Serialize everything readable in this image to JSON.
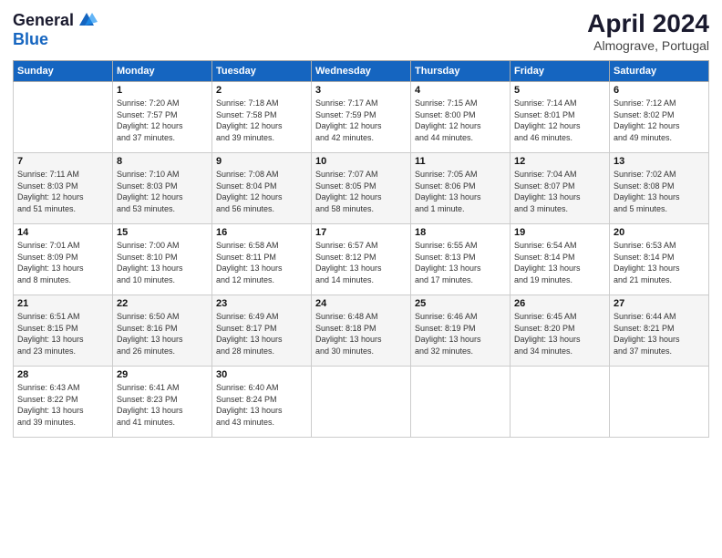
{
  "header": {
    "logo_general": "General",
    "logo_blue": "Blue",
    "main_title": "April 2024",
    "subtitle": "Almograve, Portugal"
  },
  "columns": [
    "Sunday",
    "Monday",
    "Tuesday",
    "Wednesday",
    "Thursday",
    "Friday",
    "Saturday"
  ],
  "weeks": [
    [
      {
        "day": "",
        "info": ""
      },
      {
        "day": "1",
        "info": "Sunrise: 7:20 AM\nSunset: 7:57 PM\nDaylight: 12 hours\nand 37 minutes."
      },
      {
        "day": "2",
        "info": "Sunrise: 7:18 AM\nSunset: 7:58 PM\nDaylight: 12 hours\nand 39 minutes."
      },
      {
        "day": "3",
        "info": "Sunrise: 7:17 AM\nSunset: 7:59 PM\nDaylight: 12 hours\nand 42 minutes."
      },
      {
        "day": "4",
        "info": "Sunrise: 7:15 AM\nSunset: 8:00 PM\nDaylight: 12 hours\nand 44 minutes."
      },
      {
        "day": "5",
        "info": "Sunrise: 7:14 AM\nSunset: 8:01 PM\nDaylight: 12 hours\nand 46 minutes."
      },
      {
        "day": "6",
        "info": "Sunrise: 7:12 AM\nSunset: 8:02 PM\nDaylight: 12 hours\nand 49 minutes."
      }
    ],
    [
      {
        "day": "7",
        "info": "Sunrise: 7:11 AM\nSunset: 8:03 PM\nDaylight: 12 hours\nand 51 minutes."
      },
      {
        "day": "8",
        "info": "Sunrise: 7:10 AM\nSunset: 8:03 PM\nDaylight: 12 hours\nand 53 minutes."
      },
      {
        "day": "9",
        "info": "Sunrise: 7:08 AM\nSunset: 8:04 PM\nDaylight: 12 hours\nand 56 minutes."
      },
      {
        "day": "10",
        "info": "Sunrise: 7:07 AM\nSunset: 8:05 PM\nDaylight: 12 hours\nand 58 minutes."
      },
      {
        "day": "11",
        "info": "Sunrise: 7:05 AM\nSunset: 8:06 PM\nDaylight: 13 hours\nand 1 minute."
      },
      {
        "day": "12",
        "info": "Sunrise: 7:04 AM\nSunset: 8:07 PM\nDaylight: 13 hours\nand 3 minutes."
      },
      {
        "day": "13",
        "info": "Sunrise: 7:02 AM\nSunset: 8:08 PM\nDaylight: 13 hours\nand 5 minutes."
      }
    ],
    [
      {
        "day": "14",
        "info": "Sunrise: 7:01 AM\nSunset: 8:09 PM\nDaylight: 13 hours\nand 8 minutes."
      },
      {
        "day": "15",
        "info": "Sunrise: 7:00 AM\nSunset: 8:10 PM\nDaylight: 13 hours\nand 10 minutes."
      },
      {
        "day": "16",
        "info": "Sunrise: 6:58 AM\nSunset: 8:11 PM\nDaylight: 13 hours\nand 12 minutes."
      },
      {
        "day": "17",
        "info": "Sunrise: 6:57 AM\nSunset: 8:12 PM\nDaylight: 13 hours\nand 14 minutes."
      },
      {
        "day": "18",
        "info": "Sunrise: 6:55 AM\nSunset: 8:13 PM\nDaylight: 13 hours\nand 17 minutes."
      },
      {
        "day": "19",
        "info": "Sunrise: 6:54 AM\nSunset: 8:14 PM\nDaylight: 13 hours\nand 19 minutes."
      },
      {
        "day": "20",
        "info": "Sunrise: 6:53 AM\nSunset: 8:14 PM\nDaylight: 13 hours\nand 21 minutes."
      }
    ],
    [
      {
        "day": "21",
        "info": "Sunrise: 6:51 AM\nSunset: 8:15 PM\nDaylight: 13 hours\nand 23 minutes."
      },
      {
        "day": "22",
        "info": "Sunrise: 6:50 AM\nSunset: 8:16 PM\nDaylight: 13 hours\nand 26 minutes."
      },
      {
        "day": "23",
        "info": "Sunrise: 6:49 AM\nSunset: 8:17 PM\nDaylight: 13 hours\nand 28 minutes."
      },
      {
        "day": "24",
        "info": "Sunrise: 6:48 AM\nSunset: 8:18 PM\nDaylight: 13 hours\nand 30 minutes."
      },
      {
        "day": "25",
        "info": "Sunrise: 6:46 AM\nSunset: 8:19 PM\nDaylight: 13 hours\nand 32 minutes."
      },
      {
        "day": "26",
        "info": "Sunrise: 6:45 AM\nSunset: 8:20 PM\nDaylight: 13 hours\nand 34 minutes."
      },
      {
        "day": "27",
        "info": "Sunrise: 6:44 AM\nSunset: 8:21 PM\nDaylight: 13 hours\nand 37 minutes."
      }
    ],
    [
      {
        "day": "28",
        "info": "Sunrise: 6:43 AM\nSunset: 8:22 PM\nDaylight: 13 hours\nand 39 minutes."
      },
      {
        "day": "29",
        "info": "Sunrise: 6:41 AM\nSunset: 8:23 PM\nDaylight: 13 hours\nand 41 minutes."
      },
      {
        "day": "30",
        "info": "Sunrise: 6:40 AM\nSunset: 8:24 PM\nDaylight: 13 hours\nand 43 minutes."
      },
      {
        "day": "",
        "info": ""
      },
      {
        "day": "",
        "info": ""
      },
      {
        "day": "",
        "info": ""
      },
      {
        "day": "",
        "info": ""
      }
    ]
  ]
}
